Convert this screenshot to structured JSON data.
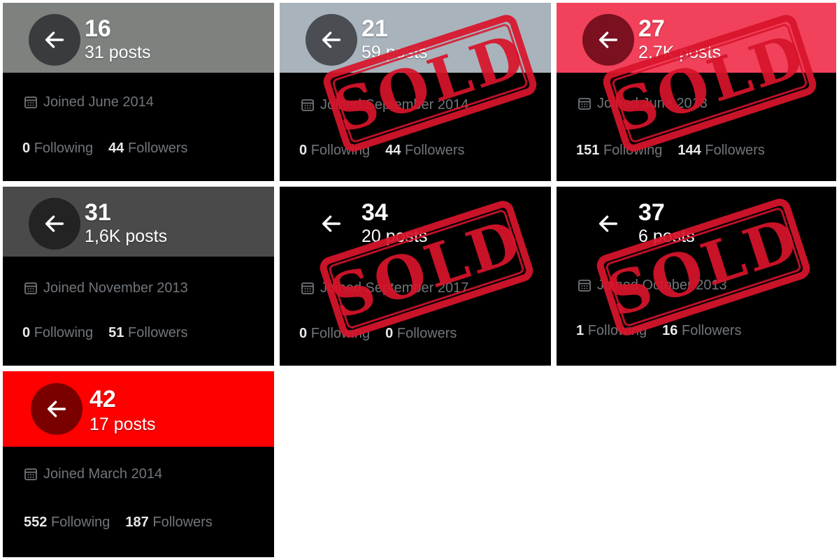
{
  "cards": [
    {
      "count": "16",
      "posts": "31 posts",
      "joined": "Joined June 2014",
      "following": "0",
      "following_label": "Following",
      "followers": "44",
      "followers_label": "Followers",
      "banner_color": "#7d827f",
      "back_color": "#3a3b3d",
      "sold": false
    },
    {
      "count": "21",
      "posts": "59 posts",
      "joined": "Joined September 2014",
      "following": "0",
      "following_label": "Following",
      "followers": "44",
      "followers_label": "Followers",
      "banner_color": "#a9b3bc",
      "back_color": "#4a4d52",
      "sold": true
    },
    {
      "count": "27",
      "posts": "2,7K posts",
      "joined": "Joined June 2013",
      "following": "151",
      "following_label": "Following",
      "followers": "144",
      "followers_label": "Followers",
      "banner_color": "#f2415a",
      "back_color": "#7a1020",
      "sold": true
    },
    {
      "count": "31",
      "posts": "1,6K posts",
      "joined": "Joined November 2013",
      "following": "0",
      "following_label": "Following",
      "followers": "51",
      "followers_label": "Followers",
      "banner_color": "#4a4a4a",
      "back_color": "#232323",
      "sold": false
    },
    {
      "count": "34",
      "posts": "20 posts",
      "joined": "Joined September 2017",
      "following": "0",
      "following_label": "Following",
      "followers": "0",
      "followers_label": "Followers",
      "banner_color": "#000000",
      "back_color": "#000000",
      "sold": true
    },
    {
      "count": "37",
      "posts": "6 posts",
      "joined": "Joined October 2013",
      "following": "1",
      "following_label": "Following",
      "followers": "16",
      "followers_label": "Followers",
      "banner_color": "#000000",
      "back_color": "#000000",
      "sold": true
    },
    {
      "count": "42",
      "posts": "17 posts",
      "joined": "Joined March 2014",
      "following": "552",
      "following_label": "Following",
      "followers": "187",
      "followers_label": "Followers",
      "banner_color": "#ff0000",
      "back_color": "#7a0000",
      "sold": false
    }
  ],
  "stamp_text": "SOLD",
  "stamp_color": "#d8142b"
}
